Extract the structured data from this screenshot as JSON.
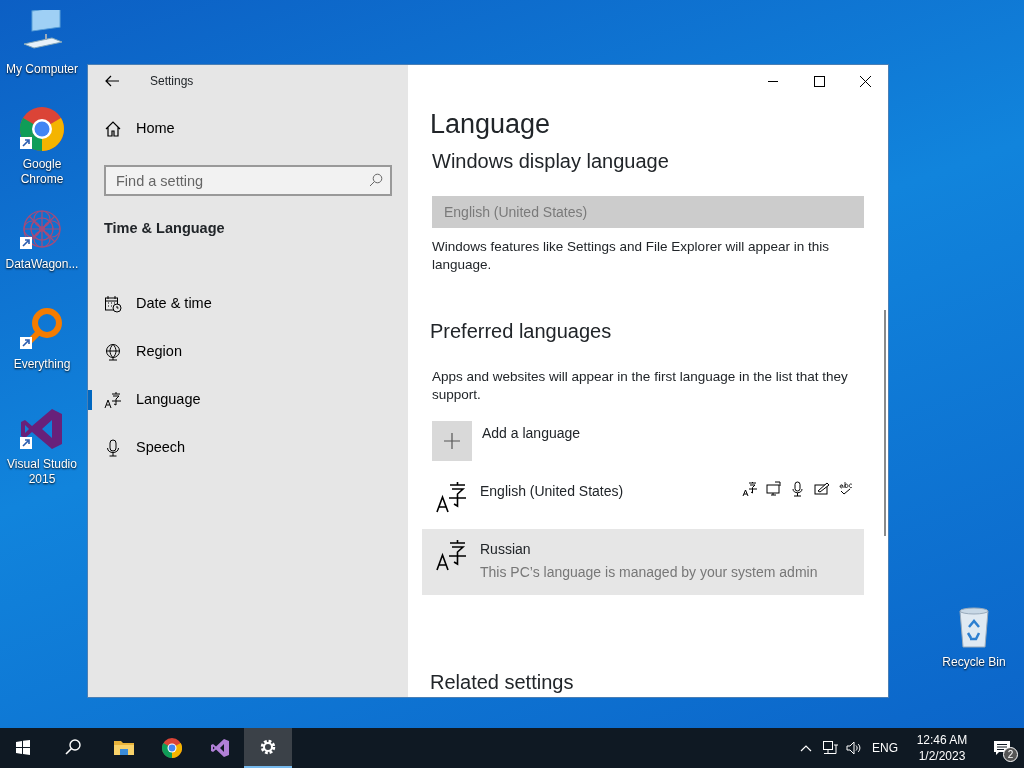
{
  "desktop_icons": [
    {
      "label": "My Computer",
      "kind": "computer",
      "shortcut": false
    },
    {
      "label": "Google Chrome",
      "kind": "chrome",
      "shortcut": true
    },
    {
      "label": "DataWagon...",
      "kind": "datawagon",
      "shortcut": true
    },
    {
      "label": "Everything",
      "kind": "everything",
      "shortcut": true
    },
    {
      "label": "Visual Studio 2015",
      "kind": "vs",
      "shortcut": true
    },
    {
      "label": "Recycle Bin",
      "kind": "recycle",
      "shortcut": false
    }
  ],
  "window": {
    "title": "Settings",
    "sidebar": {
      "home": "Home",
      "search": {
        "placeholder": "Find a setting"
      },
      "section": "Time & Language",
      "items": [
        {
          "label": "Date & time",
          "kind": "calendar",
          "selected": false
        },
        {
          "label": "Region",
          "kind": "globe",
          "selected": false
        },
        {
          "label": "Language",
          "kind": "language",
          "selected": true
        },
        {
          "label": "Speech",
          "kind": "microphone",
          "selected": false
        }
      ]
    },
    "content": {
      "heading": "Language",
      "display_language": {
        "heading": "Windows display language",
        "dropdown": {
          "value": "English (United States)",
          "disabled": true
        },
        "description": "Windows features like Settings and File Explorer will appear in this language."
      },
      "preferred": {
        "heading": "Preferred languages",
        "description": "Apps and websites will appear in the first language in the list that they support.",
        "add_label": "Add a language",
        "languages": [
          {
            "name": "English (United States)",
            "selected": false,
            "features_shown": true
          },
          {
            "name": "Russian",
            "subtitle": "This PC’s language is managed by your system admin",
            "selected": true,
            "features_shown": false
          }
        ]
      },
      "related_heading": "Related settings"
    }
  },
  "taskbar": {
    "apps": [
      {
        "kind": "start",
        "active": false
      },
      {
        "kind": "search",
        "active": false
      },
      {
        "kind": "folder",
        "active": false
      },
      {
        "kind": "chrome",
        "active": false
      },
      {
        "kind": "vs",
        "active": false
      },
      {
        "kind": "settings",
        "active": true
      }
    ],
    "tray": {
      "language": "ENG",
      "time": "12:46 AM",
      "date": "1/2/2023",
      "notifications": "2"
    }
  }
}
